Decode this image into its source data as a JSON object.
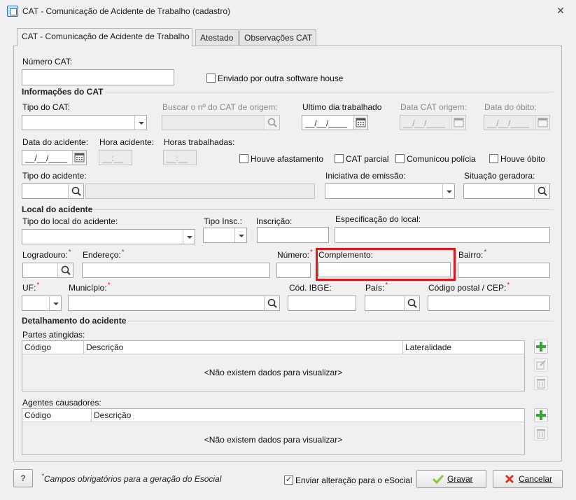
{
  "window": {
    "title": "CAT - Comunicação de Acidente de Trabalho (cadastro)"
  },
  "tabs": [
    {
      "label": "CAT - Comunicação de Acidente de Trabalho",
      "active": true
    },
    {
      "label": "Atestado",
      "active": false
    },
    {
      "label": "Observações CAT",
      "active": false
    }
  ],
  "cat": {
    "numero_label": "Número CAT:",
    "numero_value": "",
    "enviado_label": "Enviado por outra software house",
    "enviado_checked": false
  },
  "info": {
    "section": "Informações do CAT",
    "tipo_label": "Tipo do CAT:",
    "tipo_value": "",
    "buscar_label": "Buscar o nº do CAT de origem:",
    "ultimo_label": "Ultimo dia trabalhado",
    "ultimo_mask": "__/__/____",
    "data_origem_label": "Data CAT origem:",
    "data_origem_mask": "__/__/____",
    "data_obito_label": "Data do óbito:",
    "data_obito_mask": "__/__/____",
    "data_acidente_label": "Data do acidente:",
    "data_acidente_mask": "__/__/____",
    "hora_label": "Hora acidente:",
    "hora_mask": "__:__",
    "horas_trab_label": "Horas trabalhadas:",
    "horas_trab_mask": "__:__",
    "houve_afastamento": "Houve afastamento",
    "cat_parcial": "CAT parcial",
    "comunicou_policia": "Comunicou polícia",
    "houve_obito": "Houve óbito",
    "tipo_acidente_label": "Tipo do acidente:",
    "iniciativa_label": "Iniciativa de emissão:",
    "situacao_label": "Situação geradora:"
  },
  "local": {
    "section": "Local do acidente",
    "tipo_local_label": "Tipo do local do acidente:",
    "tipo_insc_label": "Tipo Insc.:",
    "inscricao_label": "Inscrição:",
    "especificacao_label": "Especificação do local:",
    "logradouro_label": "Logradouro:",
    "endereco_label": "Endereço:",
    "numero_label": "Número:",
    "complemento_label": "Complemento:",
    "bairro_label": "Bairro:",
    "uf_label": "UF:",
    "municipio_label": "Município:",
    "ibge_label": "Cód. IBGE:",
    "pais_label": "País:",
    "cep_label": "Código postal / CEP:",
    "required_mark": "*"
  },
  "detalhamento": {
    "section": "Detalhamento do acidente",
    "partes": {
      "label": "Partes atingidas:",
      "columns": [
        "Código",
        "Descrição",
        "Lateralidade"
      ],
      "empty": "<Não existem dados para visualizar>"
    },
    "agentes": {
      "label": "Agentes causadores:",
      "columns": [
        "Código",
        "Descrição"
      ],
      "empty": "<Não existem dados para visualizar>"
    }
  },
  "footer": {
    "help": "?",
    "required_mark": "*",
    "required_note": "Campos obrigatórios para a geração do Esocial",
    "enviar_label": "Enviar alteração para o eSocial",
    "enviar_checked": true,
    "save_label": "Gravar",
    "cancel_label": "Cancelar"
  },
  "colors": {
    "highlight": "#e0161e",
    "add": "#3aa33a",
    "cancel": "#d9362b",
    "save": "#8cc63e"
  }
}
